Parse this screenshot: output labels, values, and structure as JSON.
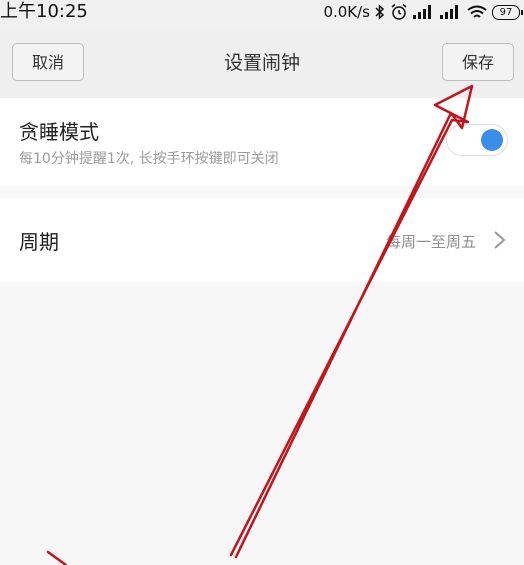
{
  "status_bar": {
    "time": "上午10:25",
    "speed": "0.0K/s",
    "battery": "97",
    "icons": [
      "bluetooth-icon",
      "alarm-icon",
      "signal-icon",
      "signal-icon",
      "wifi-icon",
      "battery-icon"
    ]
  },
  "header": {
    "cancel_label": "取消",
    "title": "设置闹钟",
    "save_label": "保存"
  },
  "snooze": {
    "title": "贪睡模式",
    "description": "每10分钟提醒1次, 长按手环按键即可关闭",
    "enabled": true
  },
  "period": {
    "label": "周期",
    "value": "每周一至周五"
  },
  "colors": {
    "toggle_on": "#3b8ee8",
    "annotation": "#c0161c"
  }
}
